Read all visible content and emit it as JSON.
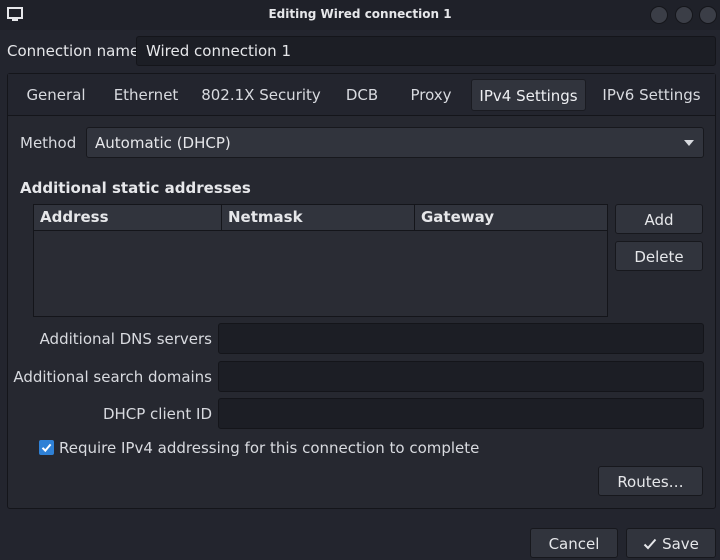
{
  "window": {
    "title": "Editing Wired connection 1"
  },
  "connection_name": {
    "label": "Connection name",
    "value": "Wired connection 1"
  },
  "tabs": [
    {
      "label": "General",
      "active": false
    },
    {
      "label": "Ethernet",
      "active": false
    },
    {
      "label": "802.1X Security",
      "active": false
    },
    {
      "label": "DCB",
      "active": false
    },
    {
      "label": "Proxy",
      "active": false
    },
    {
      "label": "IPv4 Settings",
      "active": true
    },
    {
      "label": "IPv6 Settings",
      "active": false
    }
  ],
  "method": {
    "label": "Method",
    "selected": "Automatic (DHCP)"
  },
  "addresses": {
    "title": "Additional static addresses",
    "columns": [
      "Address",
      "Netmask",
      "Gateway"
    ],
    "rows": [],
    "add_label": "Add",
    "delete_label": "Delete"
  },
  "dns": {
    "label": "Additional DNS servers",
    "value": ""
  },
  "search_domains": {
    "label": "Additional search domains",
    "value": ""
  },
  "dhcp_client_id": {
    "label": "DHCP client ID",
    "value": ""
  },
  "require_ipv4": {
    "label": "Require IPv4 addressing for this connection to complete",
    "checked": true
  },
  "routes_label": "Routes…",
  "cancel_label": "Cancel",
  "save_label": "Save",
  "colors": {
    "accent": "#2f81d6",
    "background": "#23252e",
    "field": "#1c1e25"
  }
}
